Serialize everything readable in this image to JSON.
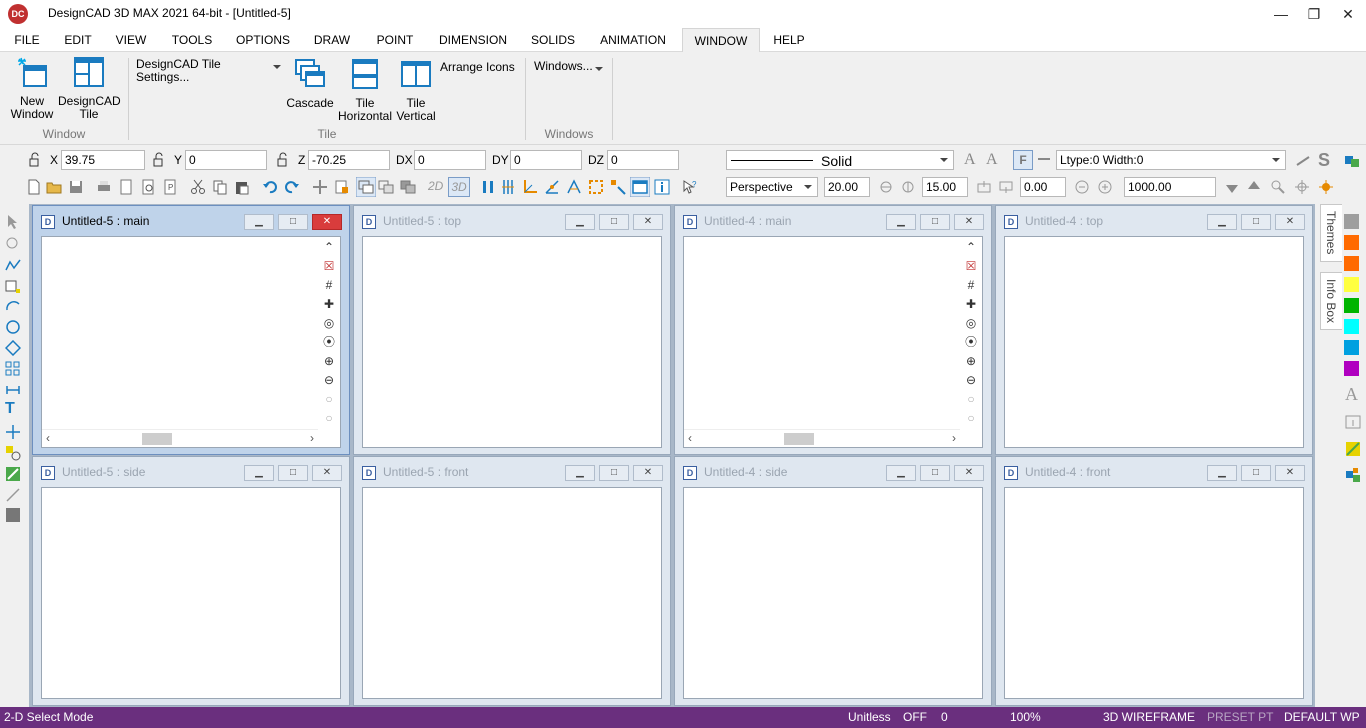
{
  "window": {
    "title": "DesignCAD 3D MAX 2021 64-bit - [Untitled-5]",
    "logo": "DC",
    "minimize": "—",
    "restore": "❐",
    "close": "✕"
  },
  "menu": [
    "FILE",
    "EDIT",
    "VIEW",
    "TOOLS",
    "OPTIONS",
    "DRAW",
    "POINT",
    "DIMENSION",
    "SOLIDS",
    "ANIMATION",
    "WINDOW",
    "HELP"
  ],
  "ribbon": {
    "new_window": "New\nWindow",
    "designcad_tile": "DesignCAD\nTile",
    "group_window": "Window",
    "tile_settings": "DesignCAD Tile Settings...",
    "cascade": "Cascade",
    "tile_horizontal": "Tile\nHorizontal",
    "tile_vertical": "Tile\nVertical",
    "arrange_icons": "Arrange Icons",
    "group_tile": "Tile",
    "windows": "Windows...",
    "group_windows": "Windows"
  },
  "coords": {
    "x_label": "X",
    "x_value": "39.75",
    "y_label": "Y",
    "y_value": "0",
    "z_label": "Z",
    "z_value": "-70.25",
    "dx_label": "DX",
    "dx_value": "0",
    "dy_label": "DY",
    "dy_value": "0",
    "dz_label": "DZ",
    "dz_value": "0"
  },
  "line": {
    "style": "Solid",
    "ltype": "Ltype:0  Width:0"
  },
  "view": {
    "projection": "Perspective",
    "field1": "20.00",
    "field2": "15.00",
    "field3": "0.00",
    "field4": "1000.00",
    "mode_2d": "2D",
    "mode_3d": "3D"
  },
  "children": [
    {
      "title": "Untitled-5 : main",
      "active": true,
      "tools": true
    },
    {
      "title": "Untitled-5 : top",
      "active": false,
      "tools": false
    },
    {
      "title": "Untitled-4 : main",
      "active": false,
      "tools": true
    },
    {
      "title": "Untitled-4 : top",
      "active": false,
      "tools": false
    },
    {
      "title": "Untitled-5 : side",
      "active": false,
      "tools": false
    },
    {
      "title": "Untitled-5 : front",
      "active": false,
      "tools": false
    },
    {
      "title": "Untitled-4 : side",
      "active": false,
      "tools": false
    },
    {
      "title": "Untitled-4 : front",
      "active": false,
      "tools": false
    }
  ],
  "child_buttons": {
    "minimize": "▁",
    "maximize": "□",
    "close": "✕"
  },
  "side_tabs": {
    "themes": "Themes",
    "info_box": "Info Box"
  },
  "swatches": [
    "#9e9e9e",
    "#ff6a00",
    "#ff6a00",
    "#ffff40",
    "#00b400",
    "#00ffff",
    "#00a0e0",
    "#b000c0"
  ],
  "status": {
    "mode": "2-D Select Mode",
    "units": "Unitless",
    "snap": "OFF",
    "layer": "0",
    "zoom": "100%",
    "render": "3D WIREFRAME",
    "preset": "PRESET PT",
    "wp": "DEFAULT WP"
  }
}
